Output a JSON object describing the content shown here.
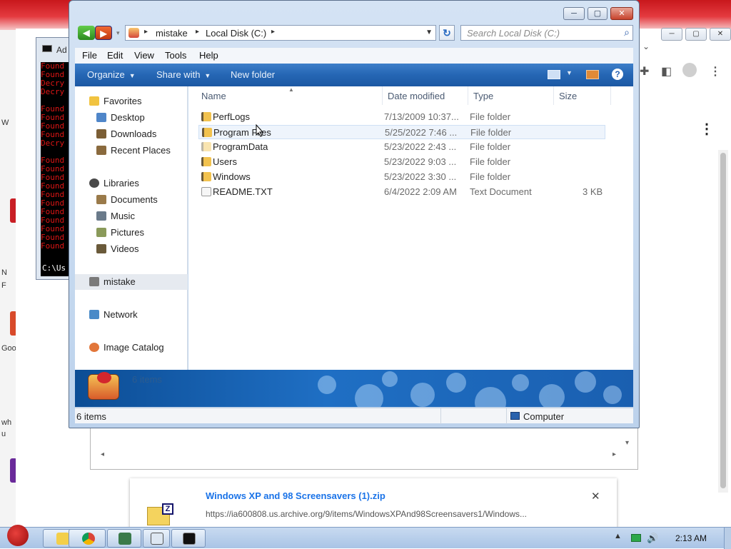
{
  "explorer": {
    "address": {
      "crumbs": [
        "mistake",
        "Local Disk (C:)"
      ]
    },
    "search": {
      "placeholder": "Search Local Disk (C:)"
    },
    "menu": [
      "File",
      "Edit",
      "View",
      "Tools",
      "Help"
    ],
    "toolbar": {
      "organize": "Organize",
      "share_with": "Share with",
      "new_folder": "New folder"
    },
    "nav": {
      "favorites": "Favorites",
      "desktop": "Desktop",
      "downloads": "Downloads",
      "recent_places": "Recent Places",
      "libraries": "Libraries",
      "documents": "Documents",
      "music": "Music",
      "pictures": "Pictures",
      "videos": "Videos",
      "homegroup": "mistake",
      "network": "Network",
      "image_catalog": "Image Catalog"
    },
    "columns": {
      "name": "Name",
      "date": "Date modified",
      "type": "Type",
      "size": "Size"
    },
    "files": [
      {
        "name": "PerfLogs",
        "date": "7/13/2009 10:37...",
        "type": "File folder",
        "size": "",
        "icon": "folder-icon"
      },
      {
        "name": "Program Files",
        "date": "5/25/2022 7:46 ...",
        "type": "File folder",
        "size": "",
        "icon": "folder-icon"
      },
      {
        "name": "ProgramData",
        "date": "5/23/2022 2:43 ...",
        "type": "File folder",
        "size": "",
        "icon": "folder-icon"
      },
      {
        "name": "Users",
        "date": "5/23/2022 9:03 ...",
        "type": "File folder",
        "size": "",
        "icon": "folder-icon"
      },
      {
        "name": "Windows",
        "date": "5/23/2022 3:30 ...",
        "type": "File folder",
        "size": "",
        "icon": "folder-icon"
      },
      {
        "name": "README.TXT",
        "date": "6/4/2022 2:09 AM",
        "type": "Text Document",
        "size": "3 KB",
        "icon": "text-document-icon"
      }
    ],
    "details_count": "6 items",
    "status": {
      "items": "6 items",
      "location": "Computer"
    },
    "colors": {
      "command_bar": "#2566b4",
      "details_pane": "#1f6fc4"
    }
  },
  "console": {
    "title": "Ad",
    "lines": [
      "Found",
      "Found",
      "Decry",
      "Decry",
      "",
      "Found",
      "Found",
      "Found",
      "Found",
      "Decry",
      "",
      "Found",
      "Found",
      "Found",
      "Found",
      "Found",
      "Found",
      "Found",
      "Found",
      "Found",
      "Found",
      "Found"
    ],
    "prompt": "C:\\Us"
  },
  "download": {
    "title": "Windows XP and 98 Screensavers (1).zip",
    "url": "https://ia600808.us.archive.org/9/items/WindowsXPAnd98Screensavers1/Windows..."
  },
  "desktop_stubs": [
    "W",
    "N",
    "F",
    "Goo",
    "wh",
    "u"
  ],
  "taskbar": {
    "time": "2:13 AM"
  }
}
